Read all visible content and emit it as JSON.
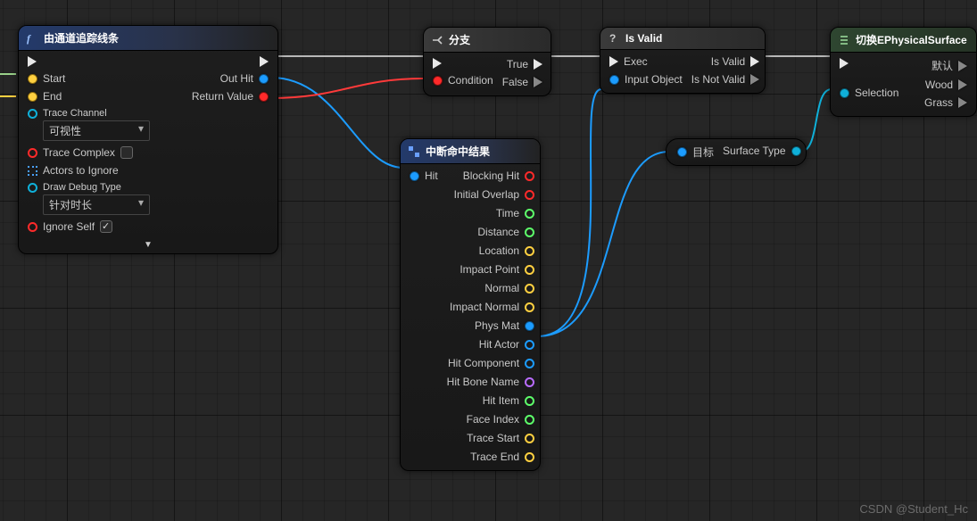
{
  "node_trace": {
    "title": "由通道追踪线条",
    "in_exec": "",
    "out_exec": "",
    "start": "Start",
    "end": "End",
    "trace_channel_label": "Trace Channel",
    "trace_channel_value": "可视性",
    "trace_complex": "Trace Complex",
    "actors_to_ignore": "Actors to Ignore",
    "draw_debug_label": "Draw Debug Type",
    "draw_debug_value": "针对时长",
    "ignore_self": "Ignore Self",
    "out_hit": "Out Hit",
    "return_value": "Return Value"
  },
  "node_branch": {
    "title": "分支",
    "condition": "Condition",
    "true": "True",
    "false": "False"
  },
  "node_isvalid": {
    "title": "Is Valid",
    "exec": "Exec",
    "input_object": "Input Object",
    "is_valid": "Is Valid",
    "is_not_valid": "Is Not Valid"
  },
  "node_switch": {
    "title": "切换EPhysicalSurface",
    "selection": "Selection",
    "default": "默认",
    "wood": "Wood",
    "grass": "Grass"
  },
  "node_break": {
    "title": "中断命中结果",
    "hit": "Hit",
    "blocking_hit": "Blocking Hit",
    "initial_overlap": "Initial Overlap",
    "time": "Time",
    "distance": "Distance",
    "location": "Location",
    "impact_point": "Impact Point",
    "normal": "Normal",
    "impact_normal": "Impact Normal",
    "phys_mat": "Phys Mat",
    "hit_actor": "Hit Actor",
    "hit_component": "Hit Component",
    "hit_bone_name": "Hit Bone Name",
    "hit_item": "Hit Item",
    "face_index": "Face Index",
    "trace_start": "Trace Start",
    "trace_end": "Trace End"
  },
  "node_surface": {
    "target": "目标",
    "surface_type": "Surface Type"
  },
  "watermark": "CSDN @Student_Hc"
}
